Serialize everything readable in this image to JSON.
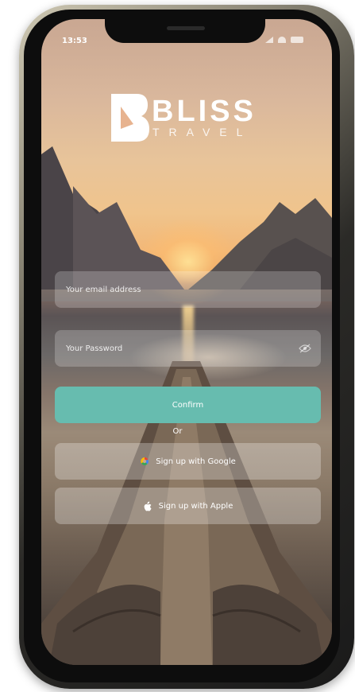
{
  "status": {
    "time": "13:53"
  },
  "brand": {
    "name": "BLISS",
    "sub": "TRAVEL"
  },
  "form": {
    "email_placeholder": "Your email address",
    "password_placeholder": "Your Password",
    "confirm_label": "Confirm",
    "or_label": "Or",
    "google_label": "Sign up with Google",
    "apple_label": "Sign up with Apple"
  },
  "colors": {
    "accent": "#67bcaf",
    "google_blue": "#4285F4",
    "google_red": "#EA4335",
    "google_yellow": "#FBBC05",
    "google_green": "#34A853"
  },
  "icons": [
    "eye-icon",
    "google-icon",
    "apple-icon",
    "signal-icon",
    "wifi-icon",
    "battery-icon"
  ]
}
